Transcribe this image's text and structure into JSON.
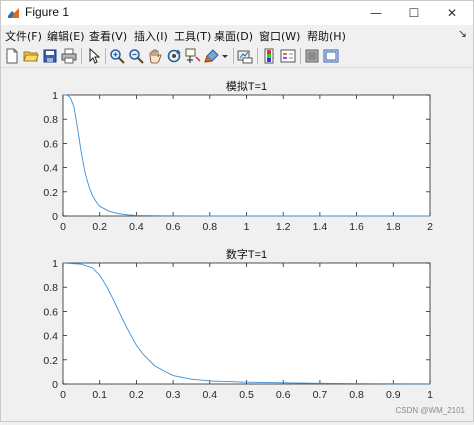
{
  "window": {
    "title": "Figure 1",
    "controls": {
      "minimize": "—",
      "maximize": "☐",
      "close": "✕"
    }
  },
  "menu": {
    "items": [
      "文件(F)",
      "编辑(E)",
      "查看(V)",
      "插入(I)",
      "工具(T)",
      "桌面(D)",
      "窗口(W)",
      "帮助(H)"
    ],
    "expand": "↘"
  },
  "toolbar": {
    "icons": [
      "new-figure-icon",
      "open-file-icon",
      "save-icon",
      "print-icon",
      "pointer-icon",
      "zoom-in-icon",
      "zoom-out-icon",
      "pan-icon",
      "rotate-3d-icon",
      "data-cursor-icon",
      "brush-icon",
      "dropdown-icon",
      "link-plot-icon",
      "insert-colorbar-icon",
      "insert-legend-icon",
      "hide-plot-tools-icon",
      "show-plot-tools-icon"
    ]
  },
  "watermark": "CSDN @WM_2101",
  "chart_data": [
    {
      "type": "line",
      "title": "模拟T=1",
      "xlabel": "",
      "ylabel": "",
      "xlim": [
        0,
        2
      ],
      "ylim": [
        0,
        1
      ],
      "xticks": [
        "0",
        "0.2",
        "0.4",
        "0.6",
        "0.8",
        "1",
        "1.2",
        "1.4",
        "1.6",
        "1.8",
        "2"
      ],
      "yticks": [
        "0",
        "0.2",
        "0.4",
        "0.6",
        "0.8",
        "1"
      ],
      "series": [
        {
          "x": [
            0,
            0.02,
            0.04,
            0.06,
            0.08,
            0.1,
            0.12,
            0.14,
            0.16,
            0.18,
            0.2,
            0.25,
            0.3,
            0.35,
            0.4,
            0.5,
            0.6,
            0.8,
            1.0,
            1.5,
            2.0
          ],
          "y": [
            1.0,
            1.0,
            0.98,
            0.9,
            0.72,
            0.52,
            0.36,
            0.25,
            0.17,
            0.12,
            0.08,
            0.04,
            0.02,
            0.01,
            0.005,
            0.002,
            0.001,
            0,
            0,
            0,
            0
          ],
          "color": "#3a8fd8"
        }
      ]
    },
    {
      "type": "line",
      "title": "数字T=1",
      "xlabel": "",
      "ylabel": "",
      "xlim": [
        0,
        1
      ],
      "ylim": [
        0,
        1
      ],
      "xticks": [
        "0",
        "0.1",
        "0.2",
        "0.3",
        "0.4",
        "0.5",
        "0.6",
        "0.7",
        "0.8",
        "0.9",
        "1"
      ],
      "yticks": [
        "0",
        "0.2",
        "0.4",
        "0.6",
        "0.8",
        "1"
      ],
      "series": [
        {
          "x": [
            0,
            0.05,
            0.08,
            0.1,
            0.12,
            0.14,
            0.16,
            0.18,
            0.2,
            0.22,
            0.25,
            0.28,
            0.3,
            0.35,
            0.4,
            0.5,
            0.6,
            0.7,
            0.8,
            0.9,
            1.0
          ],
          "y": [
            1.0,
            0.99,
            0.96,
            0.9,
            0.8,
            0.68,
            0.55,
            0.43,
            0.32,
            0.24,
            0.15,
            0.1,
            0.07,
            0.04,
            0.025,
            0.015,
            0.01,
            0.006,
            0.004,
            0.002,
            0.001
          ],
          "color": "#3a8fd8"
        }
      ]
    }
  ]
}
